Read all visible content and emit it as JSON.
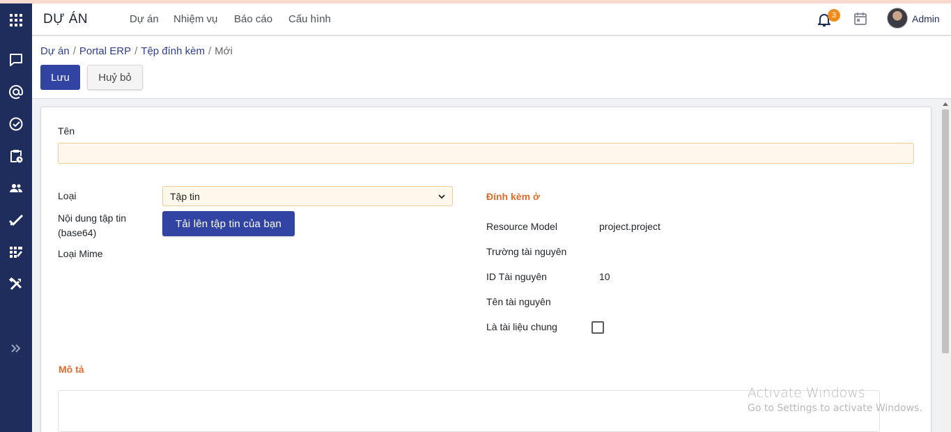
{
  "app": {
    "title": "DỰ ÁN",
    "menu": [
      "Dự án",
      "Nhiệm vụ",
      "Báo cáo",
      "Cấu hình"
    ]
  },
  "topbar_right": {
    "notification_count": "3",
    "user_name": "Admin",
    "icons": [
      "bell-icon",
      "calendar-icon",
      "avatar"
    ]
  },
  "sidebar": {
    "icons": [
      "apps-grid-icon",
      "chat-icon",
      "mention-icon",
      "check-circle-icon",
      "clipboard-clock-icon",
      "users-icon",
      "double-check-icon",
      "task-board-icon",
      "tools-icon",
      "expand-icon"
    ]
  },
  "breadcrumb": {
    "items": [
      "Dự án",
      "Portal ERP",
      "Tệp đính kèm"
    ],
    "current": "Mới"
  },
  "buttons": {
    "save": "Lưu",
    "cancel": "Huỷ bỏ",
    "upload": "Tải lên tập tin của bạn"
  },
  "form": {
    "name_label": "Tên",
    "name_value": "",
    "type_label": "Loại",
    "type_value": "Tập tin",
    "file_content_label_line1": "Nội dung tập tin",
    "file_content_label_line2": "(base64)",
    "mime_label": "Loại Mime",
    "attached_section": "Đính kèm ở",
    "resource_model_label": "Resource Model",
    "resource_model_value": "project.project",
    "resource_field_label": "Trường tài nguyên",
    "resource_id_label": "ID Tài nguyên",
    "resource_id_value": "10",
    "resource_name_label": "Tên tài nguyên",
    "public_label": "Là tài liệu chung",
    "public_checked": false,
    "description_section": "Mô tả"
  },
  "watermark": {
    "line1": "Activate Windows",
    "line2": "Go to Settings to activate Windows."
  },
  "colors": {
    "sidebar": "#1f2d5c",
    "primary": "#3244a3",
    "section_title": "#e06b2a",
    "required_field_bg": "#fef8ec",
    "badge": "#f08c1a"
  }
}
